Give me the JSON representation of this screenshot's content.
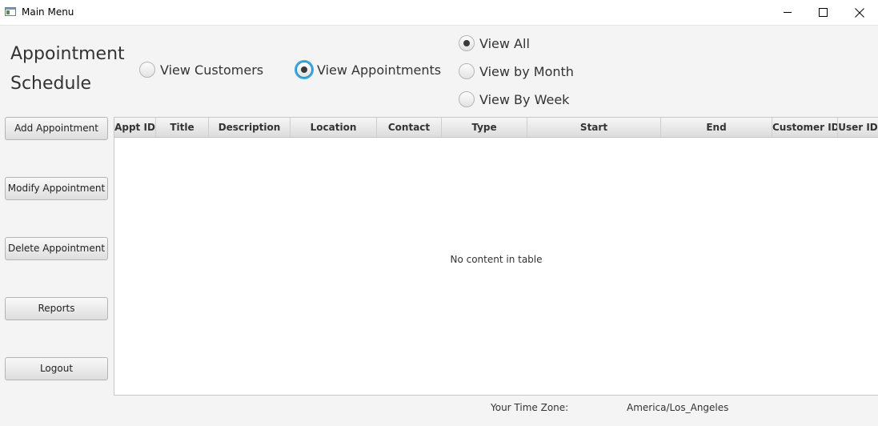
{
  "window": {
    "title": "Main Menu"
  },
  "heading": {
    "line1": "Appointment",
    "line2": "Schedule"
  },
  "view_radios": {
    "customers": "View Customers",
    "appointments": "View Appointments",
    "selected": "View Appointments"
  },
  "filter_radios": {
    "all": "View All",
    "month": "View by Month",
    "week": "View By Week",
    "selected": "View All"
  },
  "sidebar": {
    "add": "Add Appointment",
    "modify": "Modify Appointment",
    "delete": "Delete Appointment",
    "reports": "Reports",
    "logout": "Logout"
  },
  "table": {
    "columns": [
      "Appt ID",
      "Title",
      "Description",
      "Location",
      "Contact",
      "Type",
      "Start",
      "End",
      "Customer ID",
      "User ID"
    ],
    "rows": [],
    "placeholder": "No content in table"
  },
  "footer": {
    "timezone_label": "Your Time Zone:",
    "timezone_value": "America/Los_Angeles"
  },
  "icons": {
    "app": "app-window-icon",
    "minimize": "minimize-icon",
    "maximize": "maximize-icon",
    "close": "close-icon"
  }
}
